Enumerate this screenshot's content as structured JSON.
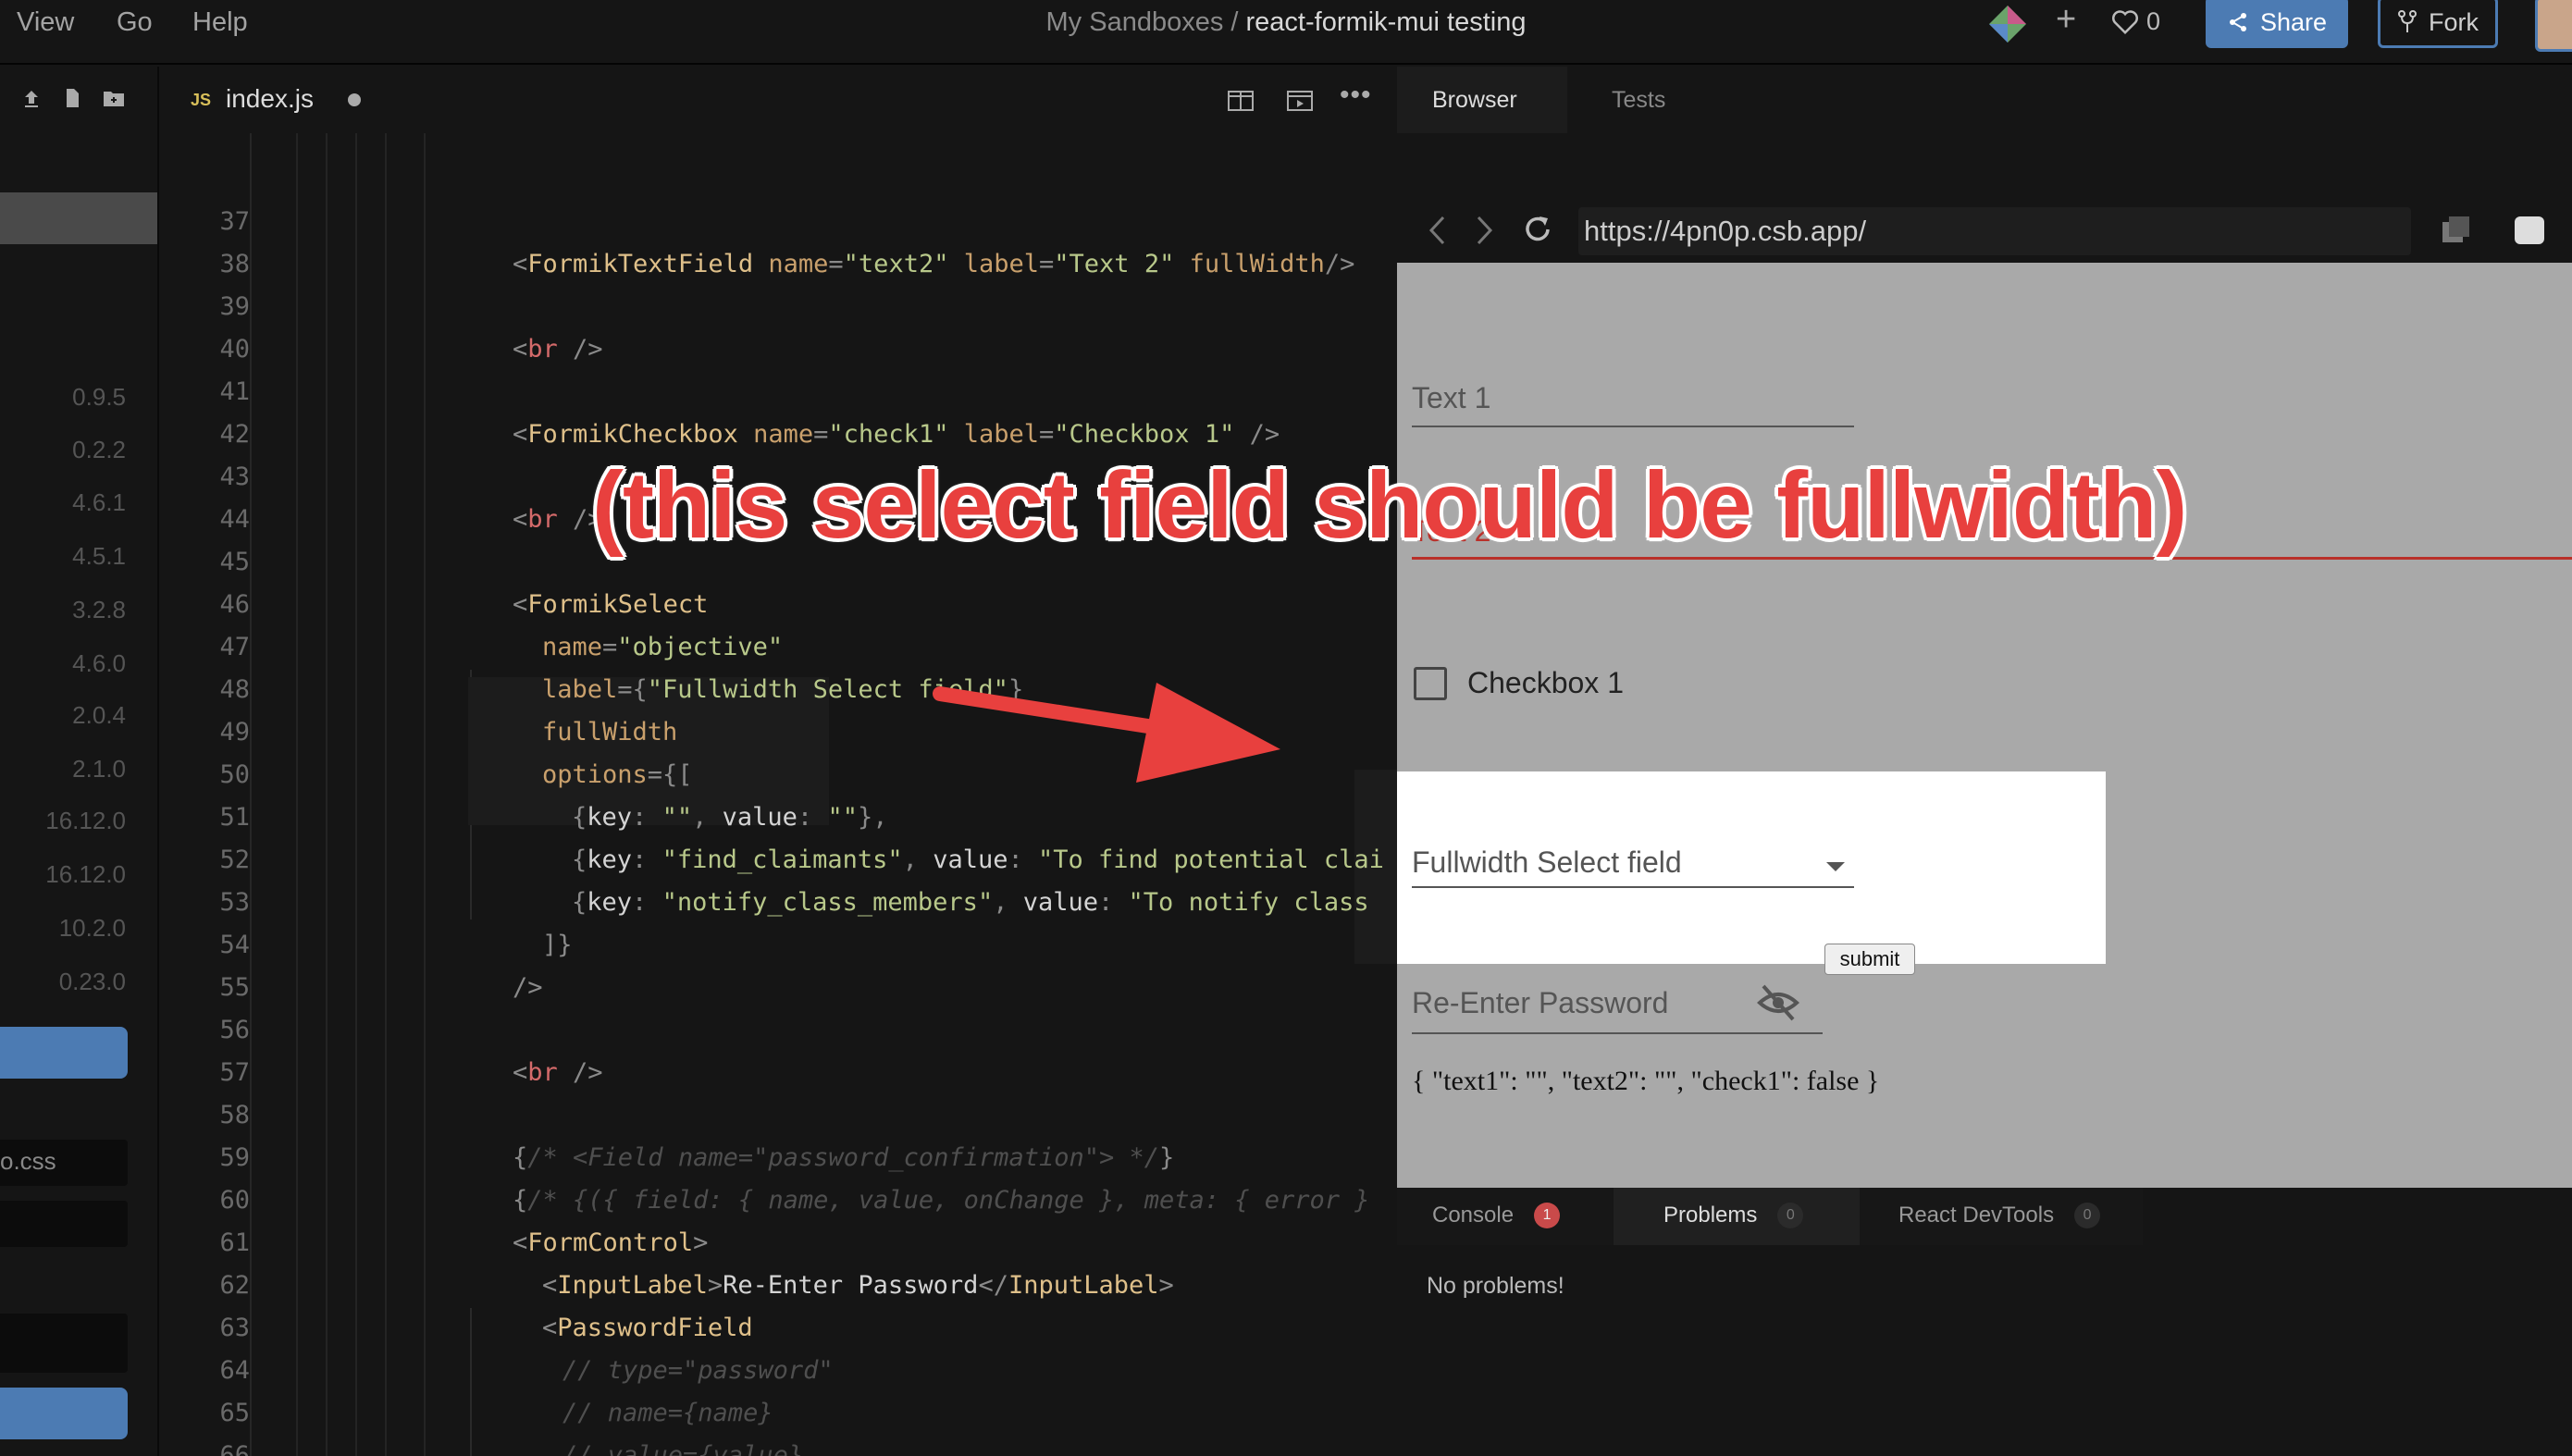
{
  "menu": {
    "view": "View",
    "go": "Go",
    "help": "Help"
  },
  "header": {
    "path": "My Sandboxes / ",
    "project": "react-formik-mui testing",
    "likes": "0",
    "share": "Share",
    "fork": "Fork"
  },
  "sidebar": {
    "versions": [
      "0.9.5",
      "0.2.2",
      "4.6.1",
      "4.5.1",
      "3.2.8",
      "4.6.0",
      "2.0.4",
      "2.1.0",
      "16.12.0",
      "16.12.0",
      "10.2.0",
      "0.23.0"
    ],
    "file_partial": "o.css"
  },
  "editor": {
    "tab_ext": "JS",
    "tab_name": "index.js"
  },
  "browser": {
    "tab_browser": "Browser",
    "tab_tests": "Tests",
    "url": "https://4pn0p.csb.app/",
    "form": {
      "text1_label": "Text 1",
      "text2_label": "Text 2",
      "checkbox_label": "Checkbox 1",
      "select_label": "Fullwidth Select field",
      "submit": "submit",
      "password_label": "Re-Enter Password",
      "values_json": "{ \"text1\": \"\", \"text2\": \"\", \"check1\": false }"
    }
  },
  "devtools": {
    "console": "Console",
    "console_count": "1",
    "problems": "Problems",
    "problems_count": "0",
    "react": "React DevTools",
    "react_count": "0",
    "message": "No problems!"
  },
  "annotation": {
    "text": "(this select field should be fullwidth)"
  },
  "colors": {
    "accent": "#4c7bb3",
    "annotation": "#e8403e",
    "error": "#c0392b"
  }
}
